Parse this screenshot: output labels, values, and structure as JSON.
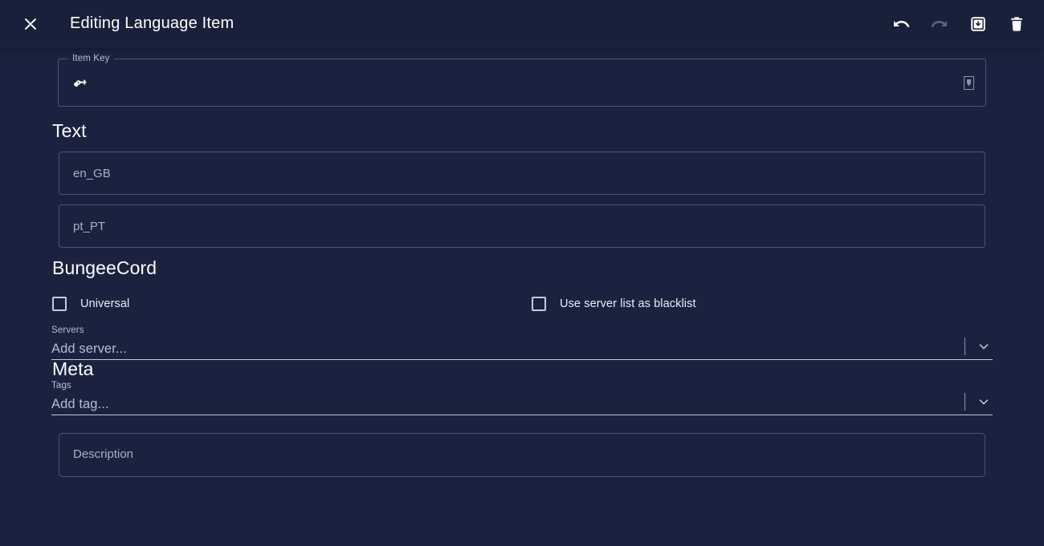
{
  "window": {
    "title": "Editing Language Item",
    "background_color": "#1a2240",
    "appbar_color": "#192039"
  },
  "appbar": {
    "close_label": "close-icon",
    "actions": [
      {
        "name": "undo-button",
        "label": "Undo",
        "enabled": true
      },
      {
        "name": "redo-button",
        "label": "Redo",
        "enabled": false
      },
      {
        "name": "save-button",
        "label": "Save",
        "enabled": true
      },
      {
        "name": "delete-button",
        "label": "Delete",
        "enabled": true
      }
    ]
  },
  "item_key": {
    "legend": "Item Key",
    "value": "",
    "placeholder": "",
    "leading_icon": "key-icon",
    "trailing_icon": "missing-glyph-icon"
  },
  "text_section": {
    "heading": "Text",
    "fields": [
      {
        "name": "text-en-gb-input",
        "placeholder": "en_GB",
        "value": ""
      },
      {
        "name": "text-pt-pt-input",
        "placeholder": "pt_PT",
        "value": ""
      }
    ]
  },
  "bungeecord_section": {
    "heading": "BungeeCord",
    "checkboxes": [
      {
        "name": "universal-checkbox",
        "label": "Universal",
        "checked": false
      },
      {
        "name": "blacklist-checkbox",
        "label": "Use server list as blacklist",
        "checked": false
      }
    ],
    "servers_select": {
      "caption": "Servers",
      "value": "Add server...",
      "chevron": "chevron-down-icon"
    }
  },
  "meta_section": {
    "heading": "Meta",
    "tags_select": {
      "caption": "Tags",
      "value": "Add tag...",
      "chevron": "chevron-down-icon"
    },
    "description": {
      "placeholder": "Description",
      "value": ""
    }
  },
  "colors": {
    "background": "#1a2240",
    "appbar": "#192039",
    "border": "#4b5573",
    "placeholder": "#a9b0c6",
    "text": "#e8eaf2",
    "disabled_icon": "#5c6684"
  }
}
